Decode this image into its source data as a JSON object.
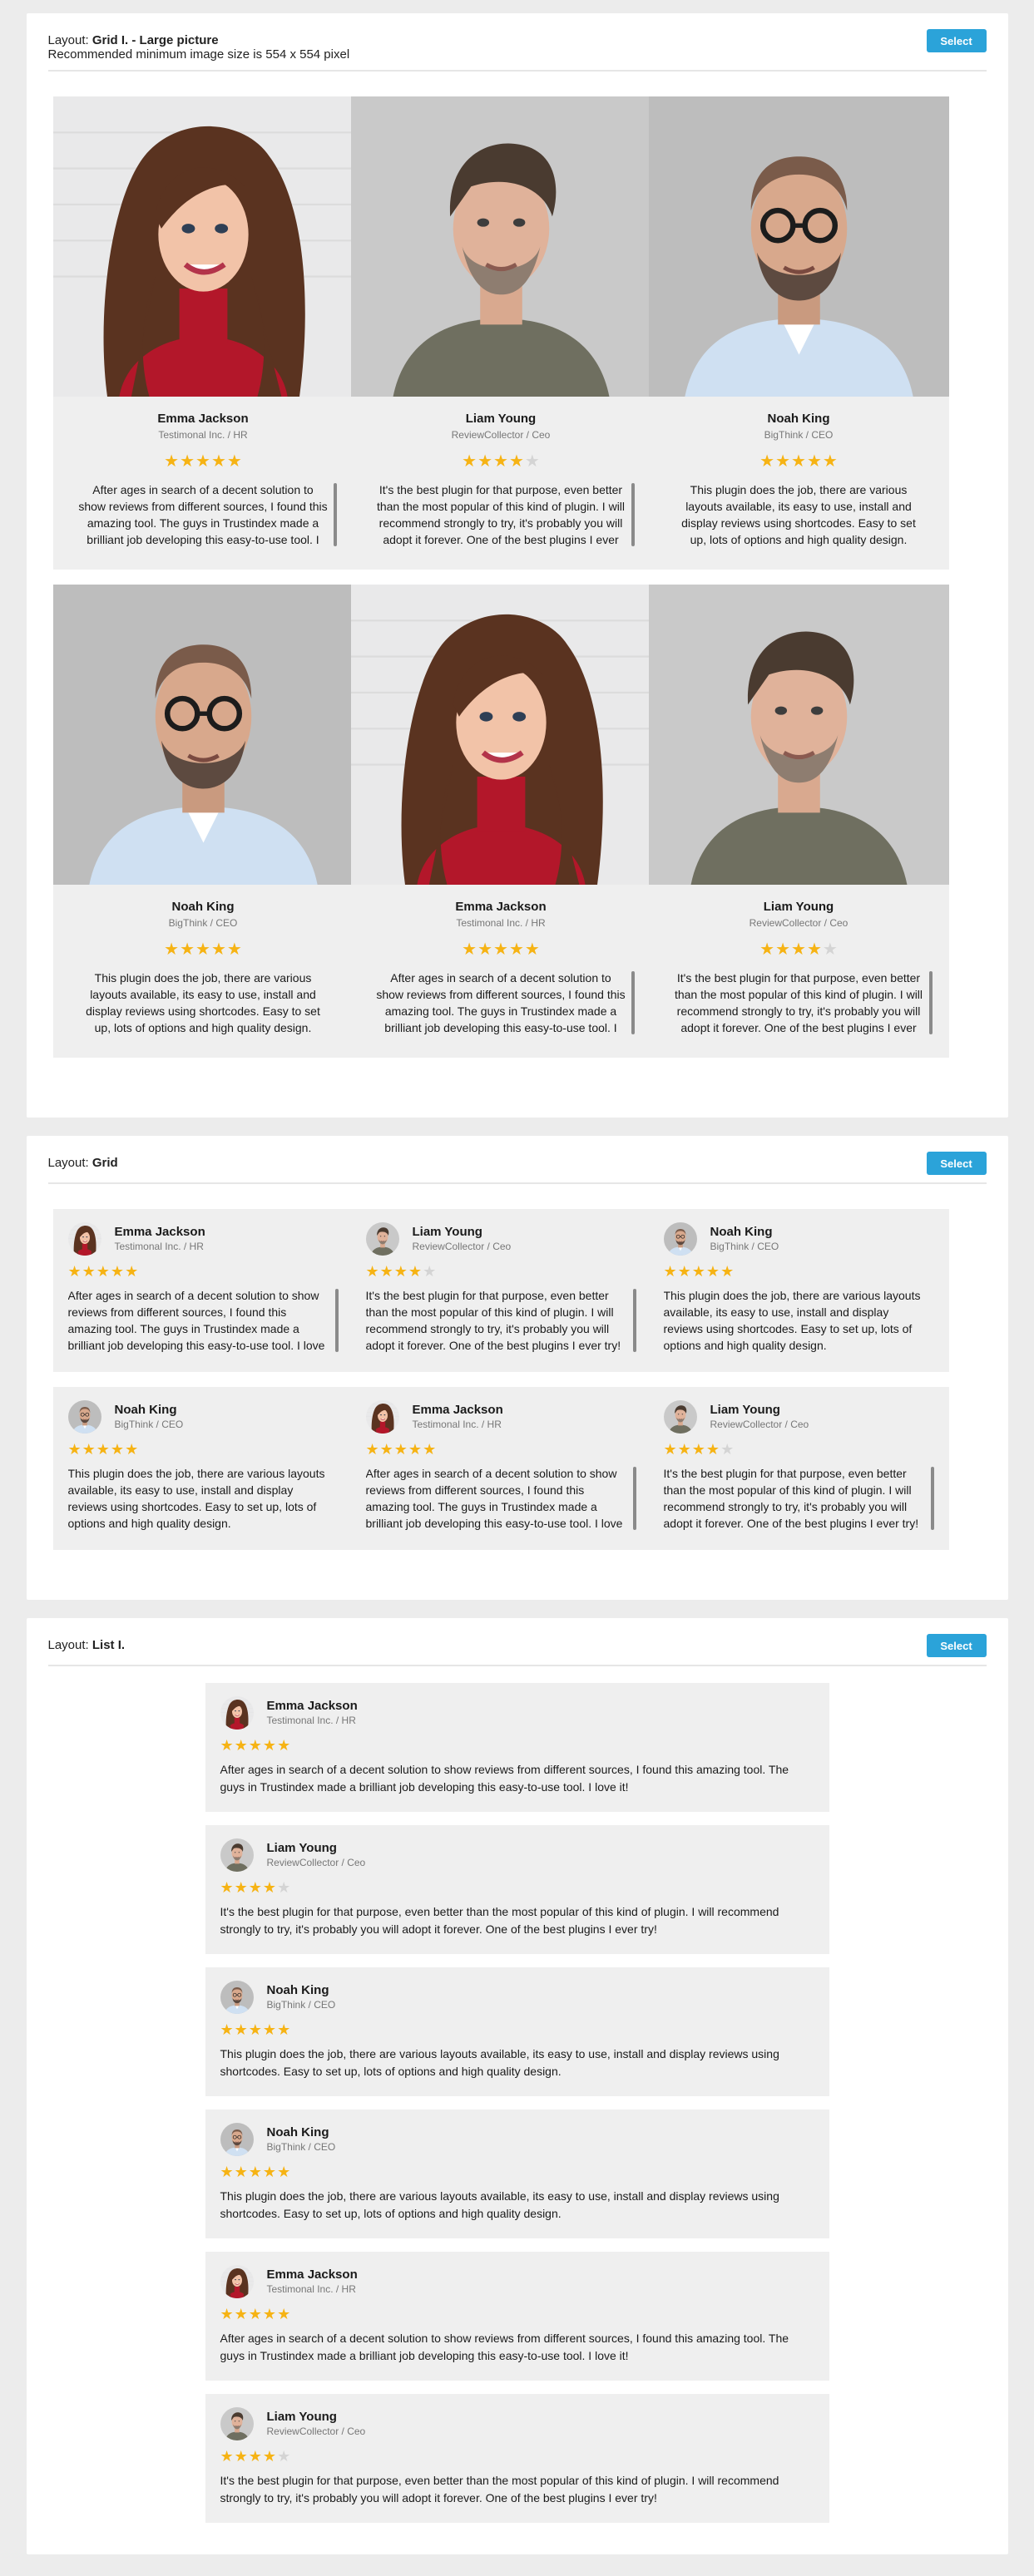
{
  "colors": {
    "accent": "#2ba3d9",
    "star_on": "#f6b314",
    "star_off": "#d4d4d4",
    "card_bg": "#efefef"
  },
  "panels": [
    {
      "layout_prefix": "Layout: ",
      "layout_name": "Grid I. - Large picture",
      "subtitle": "Recommended minimum image size is 554 x 554 pixel",
      "select_label": "Select"
    },
    {
      "layout_prefix": "Layout: ",
      "layout_name": "Grid",
      "select_label": "Select"
    },
    {
      "layout_prefix": "Layout: ",
      "layout_name": "List I.",
      "select_label": "Select"
    }
  ],
  "reviews": {
    "emma": {
      "name": "Emma Jackson",
      "company": "Testimonal Inc. / HR",
      "rating": 5,
      "avatar_icon": "woman-portrait-icon",
      "text": "After ages in search of a decent solution to show reviews from different sources, I found this amazing tool. The guys in Trustindex made a brilliant job developing this easy-to-use tool. I love it!"
    },
    "liam": {
      "name": "Liam Young",
      "company": "ReviewCollector / Ceo",
      "rating": 4,
      "avatar_icon": "man-portrait-icon",
      "text": "It's the best plugin for that purpose, even better than the most popular of this kind of plugin. I will recommend strongly to try, it's probably you will adopt it forever. One of the best plugins I ever try!"
    },
    "noah": {
      "name": "Noah King",
      "company": "BigThink / CEO",
      "rating": 5,
      "avatar_icon": "bald-man-glasses-portrait-icon",
      "text": "This plugin does the job, there are various layouts available, its easy to use, install and display reviews using shortcodes. Easy to set up, lots of options and high quality design."
    }
  },
  "large_grid_order": [
    "emma",
    "liam",
    "noah",
    "noah",
    "emma",
    "liam"
  ],
  "small_grid_order": [
    "emma",
    "liam",
    "noah",
    "noah",
    "emma",
    "liam"
  ],
  "list_order": [
    "emma",
    "liam",
    "noah",
    "noah",
    "emma",
    "liam"
  ]
}
